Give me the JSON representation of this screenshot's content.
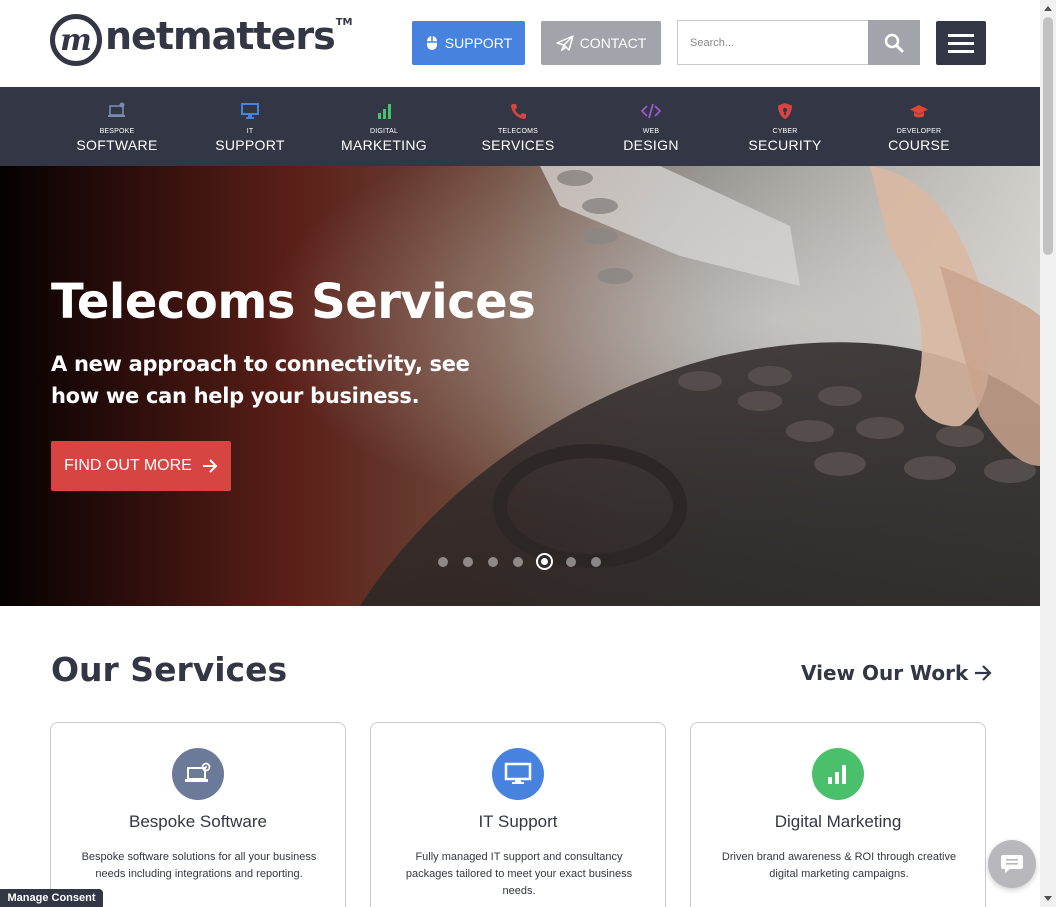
{
  "header": {
    "logo_mark": "m",
    "logo_text": "netmatters",
    "logo_tm": "TM",
    "support_label": "SUPPORT",
    "contact_label": "CONTACT",
    "search_placeholder": "Search...",
    "colors": {
      "support": "#4783de",
      "contact": "#a3a3ab",
      "dark": "#333645"
    }
  },
  "nav": {
    "items": [
      {
        "small": "Bespoke",
        "big": "Software",
        "icon": "laptop-gear-icon",
        "color": "#7b8ab4"
      },
      {
        "small": "IT",
        "big": "Support",
        "icon": "monitor-icon",
        "color": "#4783de"
      },
      {
        "small": "Digital",
        "big": "Marketing",
        "icon": "bar-chart-icon",
        "color": "#4ac06c"
      },
      {
        "small": "Telecoms",
        "big": "Services",
        "icon": "phone-icon",
        "color": "#d64541"
      },
      {
        "small": "Web",
        "big": "Design",
        "icon": "code-icon",
        "color": "#9b59d0"
      },
      {
        "small": "Cyber",
        "big": "Security",
        "icon": "shield-icon",
        "color": "#d64541"
      },
      {
        "small": "Developer",
        "big": "Course",
        "icon": "graduation-cap-icon",
        "color": "#e04535"
      }
    ]
  },
  "hero": {
    "title": "Telecoms Services",
    "subtitle": "A new approach to connectivity, see how we can help your business.",
    "cta": "FIND OUT MORE",
    "slide_count": 7,
    "active_slide": 5
  },
  "services": {
    "title": "Our Services",
    "view_work": "View Our Work",
    "cards": [
      {
        "title": "Bespoke Software",
        "desc": "Bespoke software solutions for all your business needs including integrations and reporting.",
        "icon": "laptop-gear-icon",
        "color": "#6c7a99"
      },
      {
        "title": "IT Support",
        "desc": "Fully managed IT support and consultancy packages tailored to meet your exact business needs.",
        "icon": "monitor-icon",
        "color": "#4783de"
      },
      {
        "title": "Digital Marketing",
        "desc": "Driven brand awareness & ROI through creative digital marketing campaigns.",
        "icon": "bar-chart-icon",
        "color": "#4ac06c"
      }
    ]
  },
  "footer": {
    "manage_consent": "Manage Consent"
  }
}
